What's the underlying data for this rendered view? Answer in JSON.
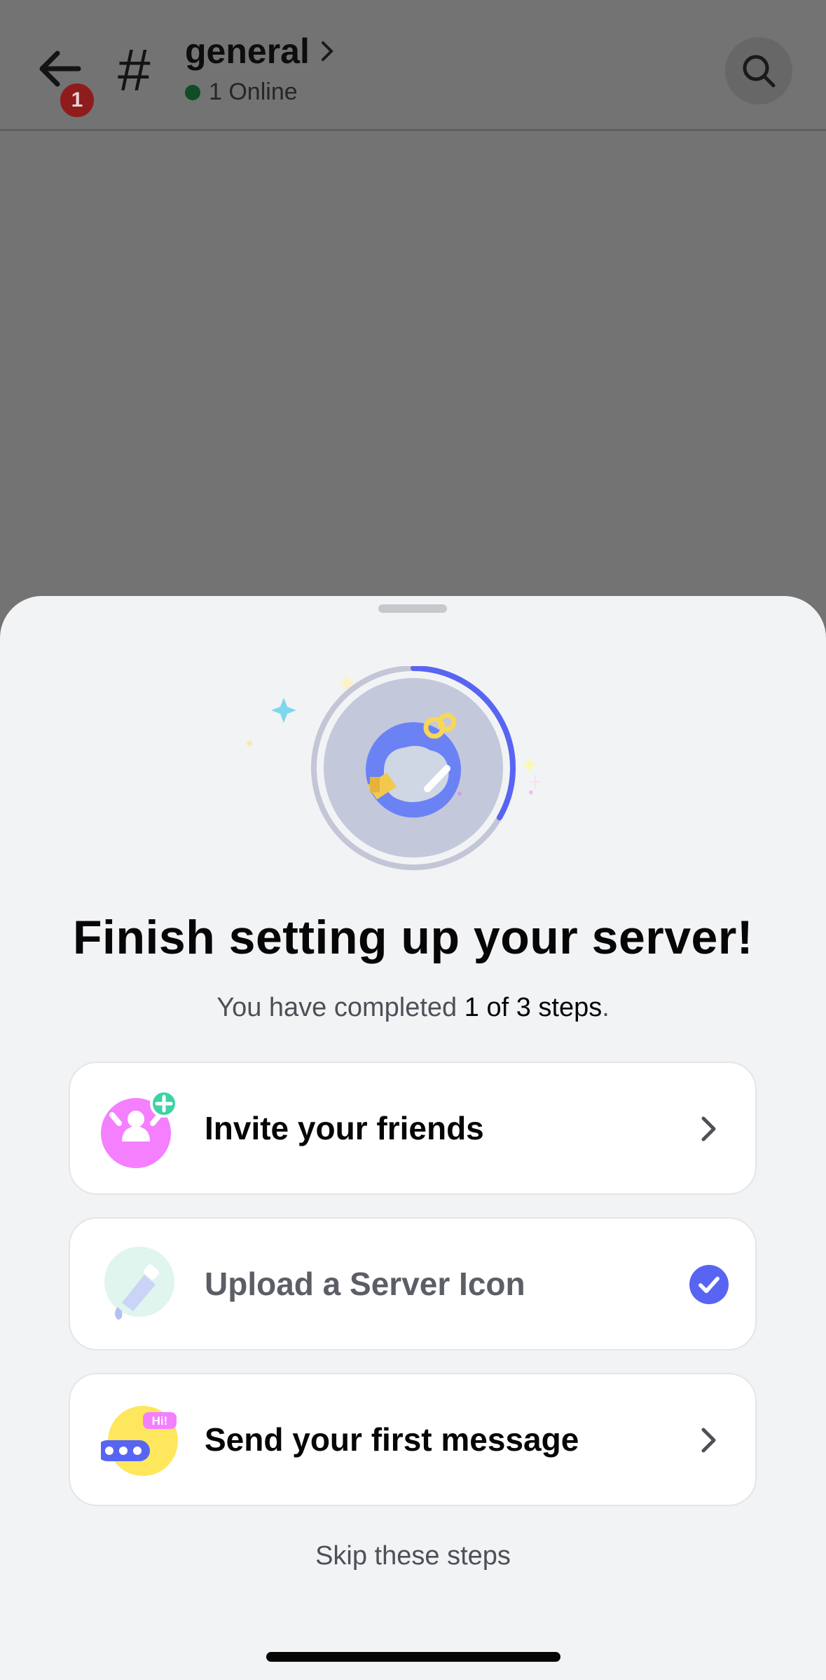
{
  "header": {
    "back_badge": "1",
    "hash_symbol": "#",
    "channel_name": "general",
    "online_text": "1 Online"
  },
  "sheet": {
    "title": "Finish setting up your server!",
    "subtitle_prefix": "You have completed ",
    "subtitle_progress": "1 of 3 steps",
    "subtitle_suffix": ".",
    "steps": [
      {
        "label": "Invite your friends",
        "completed": false,
        "icon": "invite-friends-icon"
      },
      {
        "label": "Upload a Server Icon",
        "completed": true,
        "icon": "upload-server-icon-icon"
      },
      {
        "label": "Send your first message",
        "completed": false,
        "icon": "send-message-icon",
        "icon_text": "Hi!"
      }
    ],
    "progress_fraction": 0.33,
    "skip_label": "Skip these steps"
  },
  "colors": {
    "accent": "#5865f2",
    "progress_ring": "#5865f2",
    "check": "#5865f2",
    "invite_pink": "#f47fff",
    "upload_mint": "#dff5ee",
    "message_yellow": "#fee75c"
  }
}
